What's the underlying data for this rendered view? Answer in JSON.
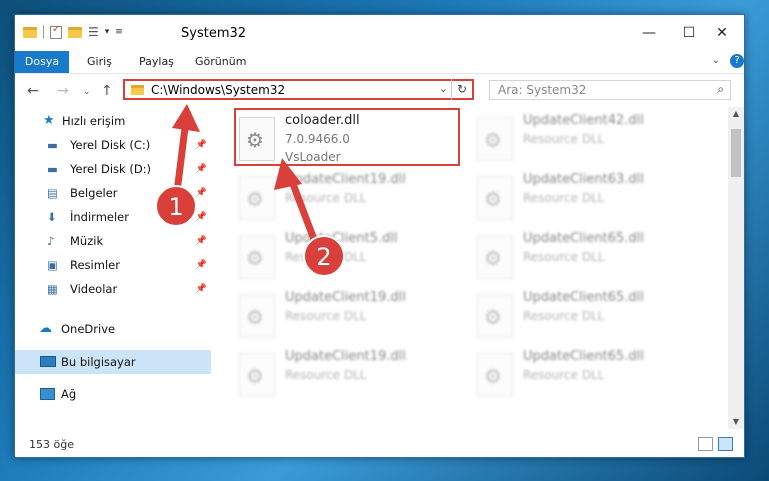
{
  "window": {
    "title": "System32"
  },
  "ribbon": {
    "tabs": [
      "Dosya",
      "Giriş",
      "Paylaş",
      "Görünüm"
    ]
  },
  "address": {
    "path": "C:\\Windows\\System32",
    "search_placeholder": "Ara: System32"
  },
  "nav": {
    "quick_access": "Hızlı erişim",
    "items": [
      {
        "label": "Yerel Disk (C:)",
        "icon": "drive-icon",
        "pinned": true
      },
      {
        "label": "Yerel Disk (D:)",
        "icon": "drive-icon",
        "pinned": true
      },
      {
        "label": "Belgeler",
        "icon": "documents-icon",
        "pinned": true
      },
      {
        "label": "İndirmeler",
        "icon": "download-icon",
        "pinned": true
      },
      {
        "label": "Müzik",
        "icon": "music-icon",
        "pinned": true
      },
      {
        "label": "Resimler",
        "icon": "pictures-icon",
        "pinned": true
      },
      {
        "label": "Videolar",
        "icon": "videos-icon",
        "pinned": true
      }
    ],
    "onedrive": "OneDrive",
    "this_pc": "Bu bilgisayar",
    "network": "Ağ"
  },
  "files": [
    {
      "name": "coloader.dll",
      "version": "7.0.9466.0",
      "desc": "VsLoader",
      "blurred": false
    },
    {
      "name": "UpdateClient42.dll",
      "desc": "Resource DLL",
      "blurred": true
    },
    {
      "name": "UpdateClient19.dll",
      "desc": "Resource DLL",
      "blurred": true
    },
    {
      "name": "UpdateClient63.dll",
      "desc": "Resource DLL",
      "blurred": true
    },
    {
      "name": "UpdateClient5.dll",
      "desc": "Resource DLL",
      "blurred": true
    },
    {
      "name": "UpdateClient65.dll",
      "desc": "Resource DLL",
      "blurred": true
    },
    {
      "name": "UpdateClient19.dll",
      "desc": "Resource DLL",
      "blurred": true
    },
    {
      "name": "UpdateClient65.dll",
      "desc": "Resource DLL",
      "blurred": true
    },
    {
      "name": "UpdateClient19.dll",
      "desc": "Resource DLL",
      "blurred": true
    },
    {
      "name": "UpdateClient65.dll",
      "desc": "Resource DLL",
      "blurred": true
    }
  ],
  "annotations": {
    "marker1": "1",
    "marker2": "2"
  },
  "status": {
    "count": "153 öğe"
  },
  "colors": {
    "accent": "#1979ca",
    "highlight": "#d9403a",
    "selection": "#cce4f7"
  }
}
